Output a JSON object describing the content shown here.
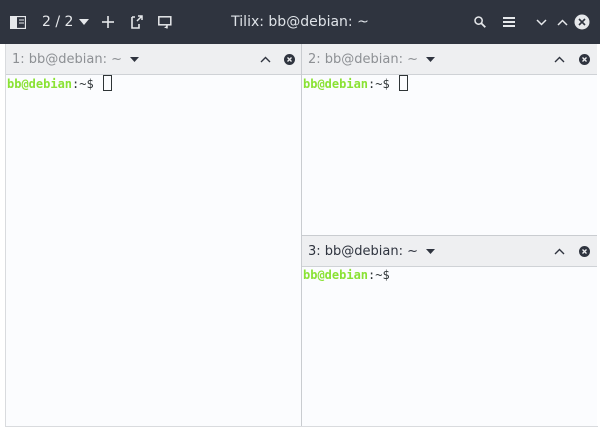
{
  "window": {
    "title": "Tilix: bb@debian: ~",
    "session_indicator": "2 / 2"
  },
  "toolbar_icons": {
    "sidebar": "sidebar-toggle-icon",
    "session_dropdown": "chevron-down-icon",
    "add": "plus-icon",
    "new_session": "new-session-icon",
    "sync_input": "sync-input-icon",
    "search": "search-icon",
    "menu": "hamburger-menu-icon",
    "minimize": "minimize-icon",
    "maximize": "maximize-icon",
    "close": "close-icon"
  },
  "panes": [
    {
      "title": "1: bb@debian: ~",
      "active": false,
      "prompt_user": "bb@debian",
      "prompt_rest": ":~$ ",
      "cursor": true
    },
    {
      "title": "2: bb@debian: ~",
      "active": true,
      "prompt_user": "bb@debian",
      "prompt_rest": ":~$ ",
      "cursor": true
    },
    {
      "title": "3: bb@debian: ~",
      "active": true,
      "prompt_user": "bb@debian",
      "prompt_rest": ":~$",
      "cursor": false
    }
  ],
  "colors": {
    "titlebar": "#2f343f",
    "prompt_user": "#8ae234",
    "terminal_bg": "#fbfcfe"
  }
}
